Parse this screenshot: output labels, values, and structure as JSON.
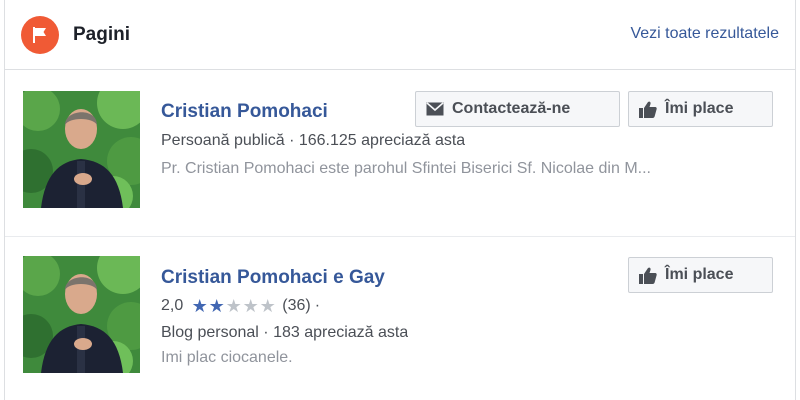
{
  "header": {
    "title": "Pagini",
    "see_all": "Vezi toate rezultatele",
    "icon": "flag-icon",
    "icon_color": "#f05a35"
  },
  "results": [
    {
      "name": "Cristian Pomohaci",
      "meta": "Persoană publică · 166.125 apreciază asta",
      "description": "Pr. Cristian Pomohaci este parohul Sfintei Biserici Sf. Nicolae din M...",
      "buttons": {
        "contact": "Contactează-ne",
        "like": "Îmi place"
      }
    },
    {
      "name": "Cristian Pomohaci e Gay",
      "rating": {
        "value": "2,0",
        "stars_filled": 2,
        "stars_total": 5,
        "count": "(36)",
        "separator": "·"
      },
      "meta": "Blog personal · 183 apreciază asta",
      "description": "Imi plac ciocanele.",
      "buttons": {
        "like": "Îmi place"
      }
    }
  ],
  "colors": {
    "link": "#365899",
    "star_filled": "#4267b2",
    "star_empty": "#bec3c9"
  }
}
